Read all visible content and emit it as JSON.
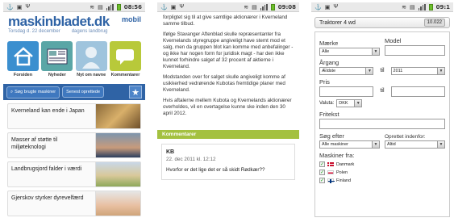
{
  "status": {
    "screen1_time": "08:56",
    "screen2_time": "09:08",
    "screen3_time": "09:1"
  },
  "home": {
    "logo": "maskinbladet.dk",
    "badge": "mobil",
    "date": "Torsdag d. 22 december",
    "tagline": "dagens landbrug",
    "tiles": [
      {
        "label": "Forsiden",
        "icon": "house-icon"
      },
      {
        "label": "Nyheder",
        "icon": "newspaper-icon"
      },
      {
        "label": "Nyt om navne",
        "icon": "person-icon"
      },
      {
        "label": "Kommentarer",
        "icon": "speech-bubble-icon"
      }
    ],
    "search_button": "Søg brugte maskiner",
    "latest_button": "Senest oprettede",
    "news": [
      {
        "title": "Kverneland kan ende i Japan"
      },
      {
        "title": "Masser af støtte til miljøteknologi"
      },
      {
        "title": "Landbrugsjord falder i værdi"
      },
      {
        "title": "Gjerskov styrker dyrevelfærd"
      }
    ]
  },
  "article": {
    "paragraphs": [
      "forpligtet sig til at give samtlige aktionærer i Kverneland samme tilbud.",
      "Ifølge Stavanger Aftenblad skulle repræsentanter fra Kvernelands styregruppe angiveligt have stemt mod et salg, men da gruppen blot kan komme med anbefalinger - og ikke har nogen form for juridisk magt - har den ikke kunnet forhindre salget af 32 procent af aktierne i Kverneland.",
      "Modstanden over for salget skulle angiveligt komme af usikkerhed vedrørende Kubotas fremtidige planer med Kverneland.",
      "Hvis aftalerne mellem Kubota og Kvernelands aktionærer overholdes, vil en overtagelse kunne ske inden den 30 april 2012."
    ],
    "comments_heading": "Kommentarer",
    "comment": {
      "author": "KB",
      "date": "22. dec 2011 kl. 12:12",
      "text": "Hvorfor er det lige det er så skidt Rødkær??"
    }
  },
  "search_form": {
    "category": "Traktorer 4 wd",
    "count": "10.022",
    "make_label": "Mærke",
    "make_value": "Alle",
    "model_label": "Model",
    "year_label": "Årgang",
    "year_from": "Ældste",
    "to_label": "til",
    "year_to": "2011",
    "price_label": "Pris",
    "currency_label": "Valuta:",
    "currency_value": "DKK",
    "freetext_label": "Fritekst",
    "search_after_label": "Søg efter",
    "search_after_value": "Alle maskiner",
    "created_label": "Oprettet indenfor:",
    "created_value": "Altid",
    "machines_from_label": "Maskiner fra:",
    "countries": [
      {
        "name": "Danmark",
        "checked": true
      },
      {
        "name": "Polen",
        "checked": true
      },
      {
        "name": "Finland",
        "checked": true
      }
    ]
  }
}
